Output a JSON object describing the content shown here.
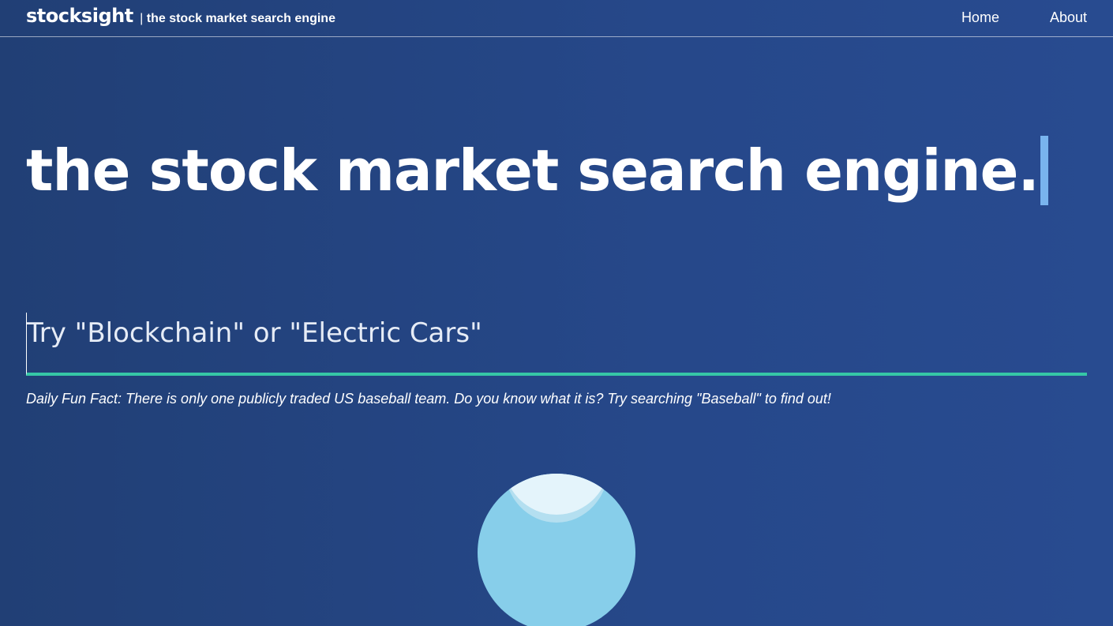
{
  "nav": {
    "brand_name": "stocksight",
    "brand_separator": "|",
    "brand_tagline": "the stock market search engine",
    "links": [
      {
        "label": "Home"
      },
      {
        "label": "About"
      }
    ]
  },
  "hero": {
    "title": "the stock market search engine."
  },
  "search": {
    "placeholder": "Try \"Blockchain\" or \"Electric Cars\"",
    "value": ""
  },
  "fun_fact": {
    "text": "Daily Fun Fact: There is only one publicly traded US baseball team. Do you know what it is? Try searching \"Baseball\" to find out!"
  },
  "colors": {
    "background": "#244585",
    "accent_underline": "#36c7a6",
    "cursor": "#79b4ee",
    "illustration": "#87ceea"
  }
}
